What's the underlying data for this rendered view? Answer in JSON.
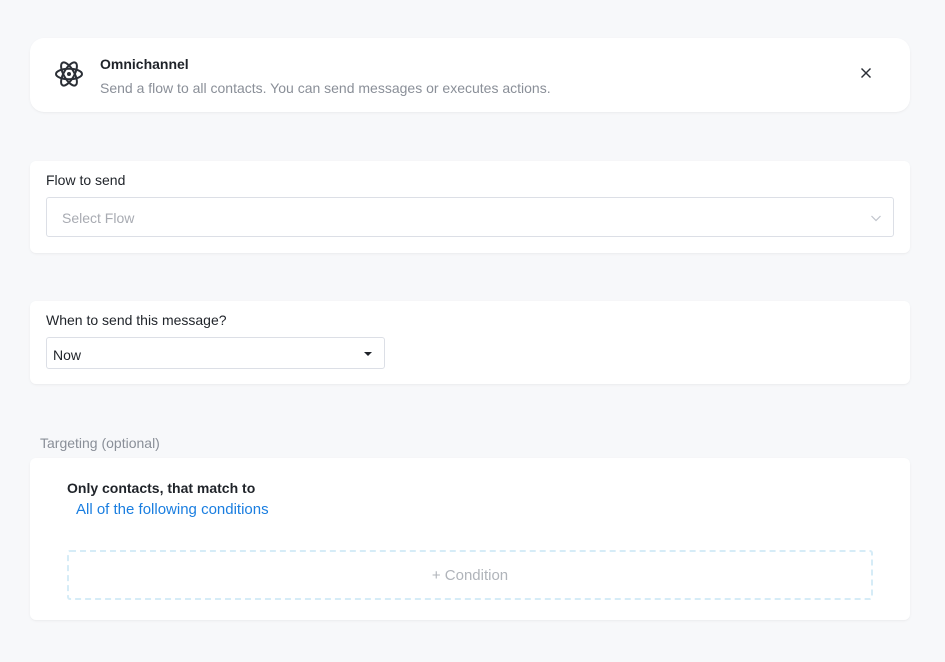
{
  "header": {
    "icon": "atom-icon",
    "title": "Omnichannel",
    "description": "Send a flow to all contacts. You can send messages or executes actions.",
    "close_icon": "close-icon"
  },
  "flow": {
    "label": "Flow to send",
    "placeholder": "Select Flow",
    "chevron_icon": "chevron-down-icon"
  },
  "schedule": {
    "label": "When to send this message?",
    "selected": "Now",
    "caret_icon": "caret-down-icon"
  },
  "targeting": {
    "section_title": "Targeting (optional)",
    "match_label": "Only contacts, that match to",
    "match_mode": "All of the following conditions",
    "add_condition_label": "+ Condition"
  },
  "colors": {
    "link": "#1a7ee0",
    "background": "#f7f8fa",
    "dashed_border": "#d6ecf7"
  }
}
